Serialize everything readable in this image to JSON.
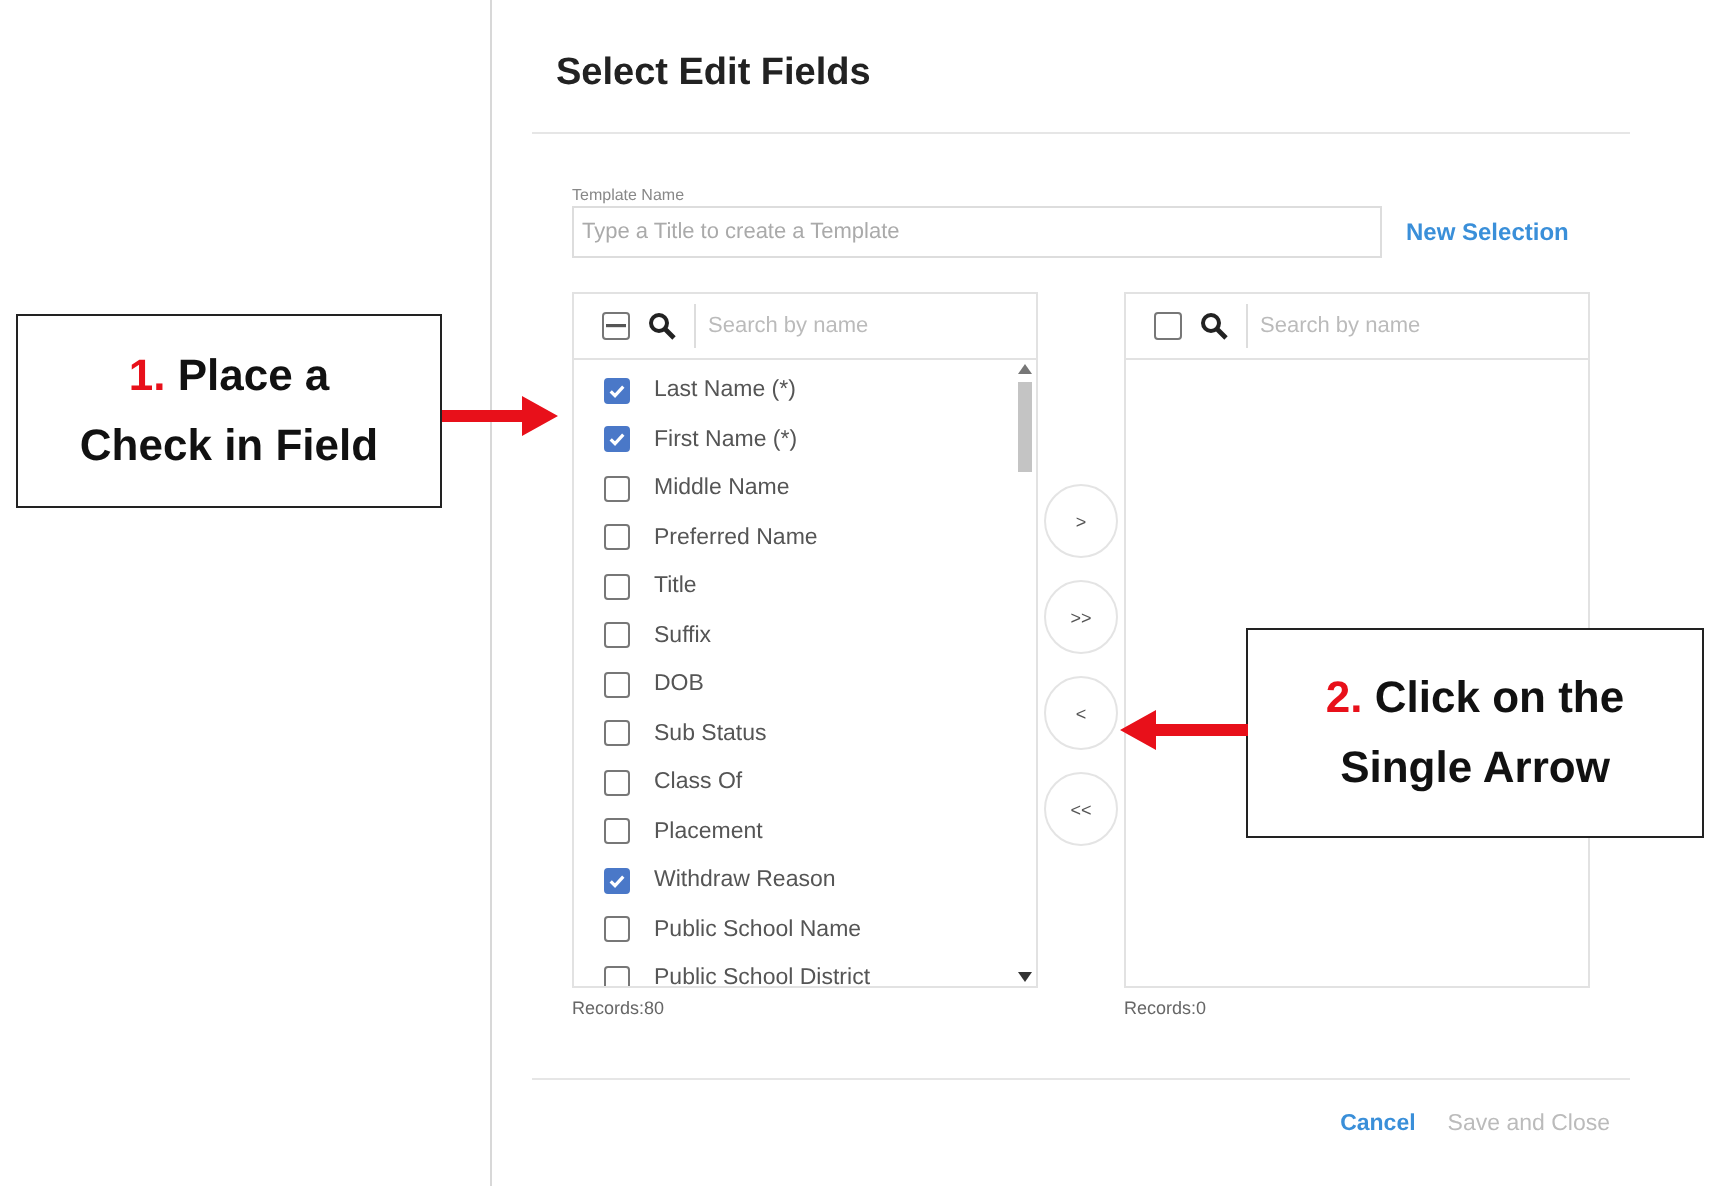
{
  "dialog": {
    "title": "Select Edit Fields",
    "template": {
      "label": "Template Name",
      "placeholder": "Type a Title to create a Template"
    },
    "new_selection": "New Selection",
    "source": {
      "header_indeterminate": true,
      "search_placeholder": "Search by name",
      "records": "Records:80",
      "items": [
        {
          "label": "Last Name (*)",
          "checked": true
        },
        {
          "label": "First Name (*)",
          "checked": true
        },
        {
          "label": "Middle Name",
          "checked": false
        },
        {
          "label": "Preferred Name",
          "checked": false
        },
        {
          "label": "Title",
          "checked": false
        },
        {
          "label": "Suffix",
          "checked": false
        },
        {
          "label": "DOB",
          "checked": false
        },
        {
          "label": "Sub Status",
          "checked": false
        },
        {
          "label": "Class Of",
          "checked": false
        },
        {
          "label": "Placement",
          "checked": false
        },
        {
          "label": "Withdraw Reason",
          "checked": true
        },
        {
          "label": "Public School Name",
          "checked": false
        },
        {
          "label": "Public School District",
          "checked": false
        }
      ]
    },
    "move_buttons": [
      ">",
      ">>",
      "<",
      "<<"
    ],
    "target": {
      "header_indeterminate": false,
      "search_placeholder": "Search by name",
      "records": "Records:0"
    },
    "buttons": [
      {
        "label": "Cancel",
        "disabled": false
      },
      {
        "label": "Save and Close",
        "disabled": true
      }
    ]
  },
  "callouts": [
    {
      "number": "1.",
      "text": "Place a Check in Field"
    },
    {
      "number": "2.",
      "text": "Click on the Single Arrow"
    }
  ]
}
